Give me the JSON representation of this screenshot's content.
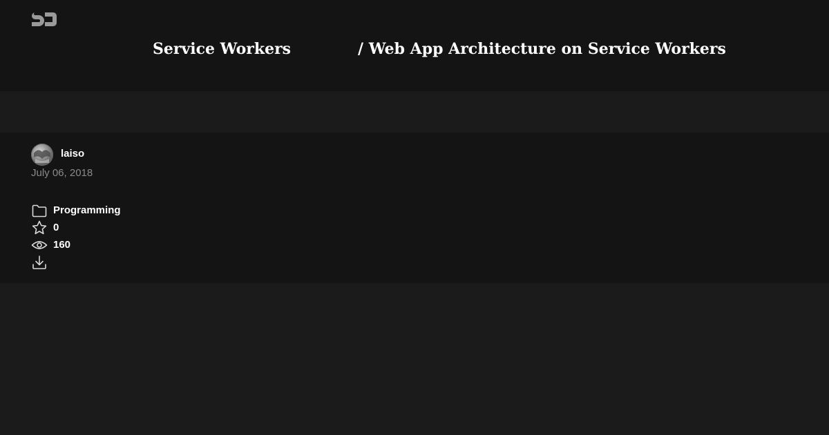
{
  "header": {
    "logo_icon": "sj-logo-icon",
    "deck_title": "Service Workers",
    "slide_title": "/ Web App Architecture on Service Workers"
  },
  "author": {
    "name": "laiso",
    "avatar_icon": "user-avatar",
    "date": "July 06, 2018"
  },
  "stats": {
    "category": {
      "icon": "folder-icon",
      "label": "Programming"
    },
    "stars": {
      "icon": "star-icon",
      "value": "0"
    },
    "views": {
      "icon": "eye-icon",
      "value": "160"
    },
    "download": {
      "icon": "download-icon"
    }
  },
  "colors": {
    "header_bg": "#141414",
    "page_bg": "#1b1b1b",
    "text": "#ffffff",
    "muted_text": "#8a8a8a",
    "icon_stroke": "#d9d9d9"
  }
}
